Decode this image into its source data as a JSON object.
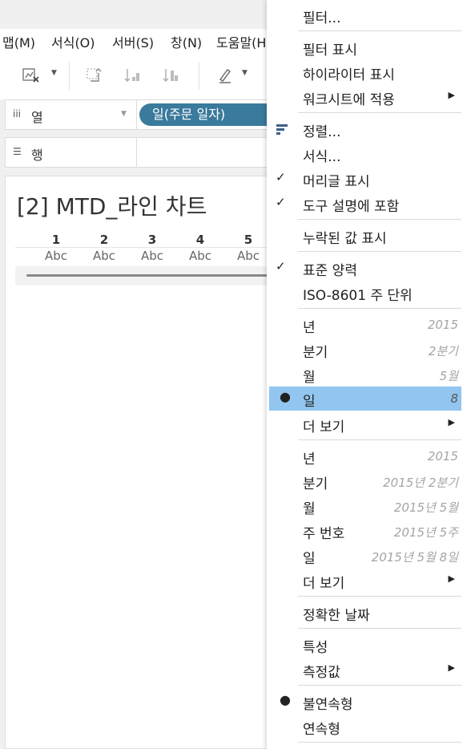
{
  "menubar": {
    "items": [
      "맵(M)",
      "서식(O)",
      "서버(S)",
      "창(N)",
      "도움말(H)"
    ]
  },
  "shelves": {
    "columns_label": "열",
    "rows_label": "행",
    "columns_pill": "일(주문 일자)"
  },
  "sheet": {
    "title": "[2] MTD_라인 차트",
    "headers": [
      "1",
      "2",
      "3",
      "4",
      "5"
    ],
    "cells": [
      "Abc",
      "Abc",
      "Abc",
      "Abc",
      "Abc"
    ]
  },
  "menu": {
    "filter": "필터...",
    "show_filter": "필터 표시",
    "show_highlighter": "하이라이터 표시",
    "apply_to_worksheets": "워크시트에 적용",
    "sort": "정렬...",
    "format": "서식...",
    "show_header": "머리글 표시",
    "include_in_tooltip": "도구 설명에 포함",
    "show_missing_values": "누락된 값 표시",
    "standard_calendar": "표준 양력",
    "iso_week": "ISO-8601 주 단위",
    "dp1": [
      {
        "label": "년",
        "example": "2015"
      },
      {
        "label": "분기",
        "example": "2분기"
      },
      {
        "label": "월",
        "example": "5월"
      },
      {
        "label": "일",
        "example": "8"
      }
    ],
    "more_1": "더 보기",
    "dp2": [
      {
        "label": "년",
        "example": "2015"
      },
      {
        "label": "분기",
        "example": "2015년 2분기"
      },
      {
        "label": "월",
        "example": "2015년 5월"
      },
      {
        "label": "주 번호",
        "example": "2015년 5주"
      },
      {
        "label": "일",
        "example": "2015년 5월 8일"
      }
    ],
    "more_2": "더 보기",
    "exact_date": "정확한 날짜",
    "attribute": "특성",
    "measure": "측정값",
    "discrete": "불연속형",
    "continuous": "연속형"
  },
  "icons": {
    "menu_check": "checkmark-icon",
    "menu_dot": "bullet-icon",
    "submenu": "submenu-arrow-icon"
  },
  "colors": {
    "pill": "#3a7a9c",
    "selected": "#92c5f0",
    "sort_icon": "#3c5f8a"
  }
}
